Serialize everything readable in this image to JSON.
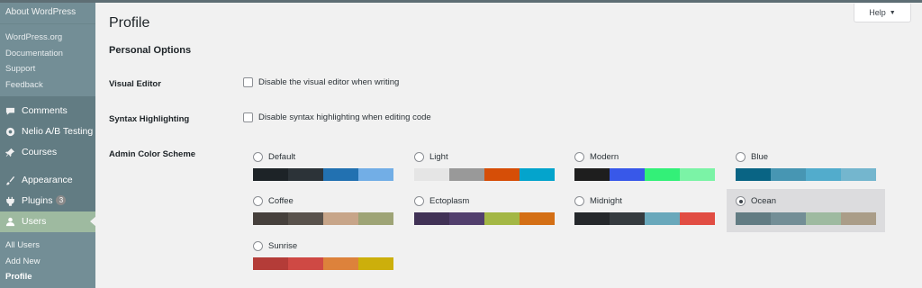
{
  "sidebar": {
    "flyout": {
      "about": "About WordPress",
      "links": [
        "WordPress.org",
        "Documentation",
        "Support",
        "Feedback"
      ]
    },
    "menu": [
      {
        "label": "Comments",
        "icon": "comment-icon"
      },
      {
        "label": "Nelio A/B Testing",
        "icon": "nelio-icon"
      },
      {
        "label": "Courses",
        "icon": "pin-icon"
      }
    ],
    "menu2": [
      {
        "label": "Appearance",
        "icon": "brush-icon"
      },
      {
        "label": "Plugins",
        "icon": "plug-icon",
        "badge": "3"
      },
      {
        "label": "Users",
        "icon": "user-icon",
        "active": true
      }
    ],
    "users_sub": [
      {
        "label": "All Users"
      },
      {
        "label": "Add New"
      },
      {
        "label": "Profile",
        "current": true
      }
    ]
  },
  "header": {
    "help_label": "Help",
    "page_title": "Profile"
  },
  "personal_options": {
    "section_title": "Personal Options",
    "visual_editor": {
      "label": "Visual Editor",
      "checkbox_label": "Disable the visual editor when writing",
      "checked": false
    },
    "syntax_highlighting": {
      "label": "Syntax Highlighting",
      "checkbox_label": "Disable syntax highlighting when editing code",
      "checked": false
    },
    "color_scheme": {
      "label": "Admin Color Scheme",
      "selected": "Ocean",
      "schemes": [
        {
          "name": "Default",
          "colors": [
            "#1d2327",
            "#2c3338",
            "#2271b1",
            "#72aee6"
          ]
        },
        {
          "name": "Light",
          "colors": [
            "#e5e5e5",
            "#999999",
            "#d64e07",
            "#04a4cc"
          ]
        },
        {
          "name": "Modern",
          "colors": [
            "#1e1e1e",
            "#3858e9",
            "#33f078",
            "#7bf3a6"
          ]
        },
        {
          "name": "Blue",
          "colors": [
            "#096484",
            "#4796b3",
            "#52accc",
            "#74b6ce"
          ]
        },
        {
          "name": "Coffee",
          "colors": [
            "#46403c",
            "#59524c",
            "#c7a589",
            "#9ea476"
          ]
        },
        {
          "name": "Ectoplasm",
          "colors": [
            "#413256",
            "#523f6d",
            "#a3b745",
            "#d46f15"
          ]
        },
        {
          "name": "Midnight",
          "colors": [
            "#25282b",
            "#363b3f",
            "#69a8bb",
            "#e14d43"
          ]
        },
        {
          "name": "Ocean",
          "colors": [
            "#627c83",
            "#738e96",
            "#9ebaa0",
            "#aa9d88"
          ]
        },
        {
          "name": "Sunrise",
          "colors": [
            "#b43c38",
            "#cf4944",
            "#dd823b",
            "#ccaf0b"
          ]
        }
      ]
    }
  },
  "colors": {
    "sidebar_bg": "#627c83",
    "sidebar_active": "#9ebaa0",
    "page_bg": "#f1f1f1"
  }
}
